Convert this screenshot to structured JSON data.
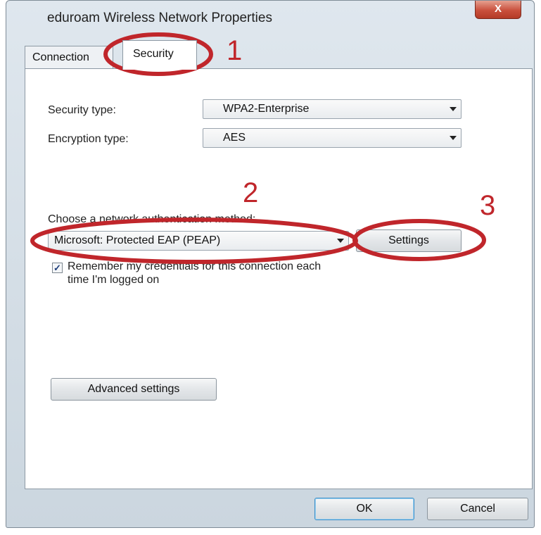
{
  "window": {
    "title": "eduroam  Wireless Network Properties",
    "close_glyph": "X"
  },
  "tabs": [
    {
      "label": "Connection"
    },
    {
      "label": "Security"
    }
  ],
  "security": {
    "security_type_label": "Security type:",
    "security_type_value": "WPA2-Enterprise",
    "encryption_type_label": "Encryption type:",
    "encryption_type_value": "AES",
    "auth_method_label": "Choose a network authentication method:",
    "auth_method_value": "Microsoft: Protected EAP (PEAP)",
    "settings_button": "Settings",
    "remember_checked": true,
    "remember_label_line1": "Remember my credentials for this connection each",
    "remember_label_line2": "time I'm logged on",
    "advanced_button": "Advanced settings"
  },
  "footer": {
    "ok_button": "OK",
    "cancel_button": "Cancel"
  },
  "annotations": [
    {
      "number": "1"
    },
    {
      "number": "2"
    },
    {
      "number": "3"
    }
  ],
  "annotation_color": "#c0262b",
  "icons": {
    "combo_arrow": "triangle-down",
    "checkbox": "check-mark"
  }
}
